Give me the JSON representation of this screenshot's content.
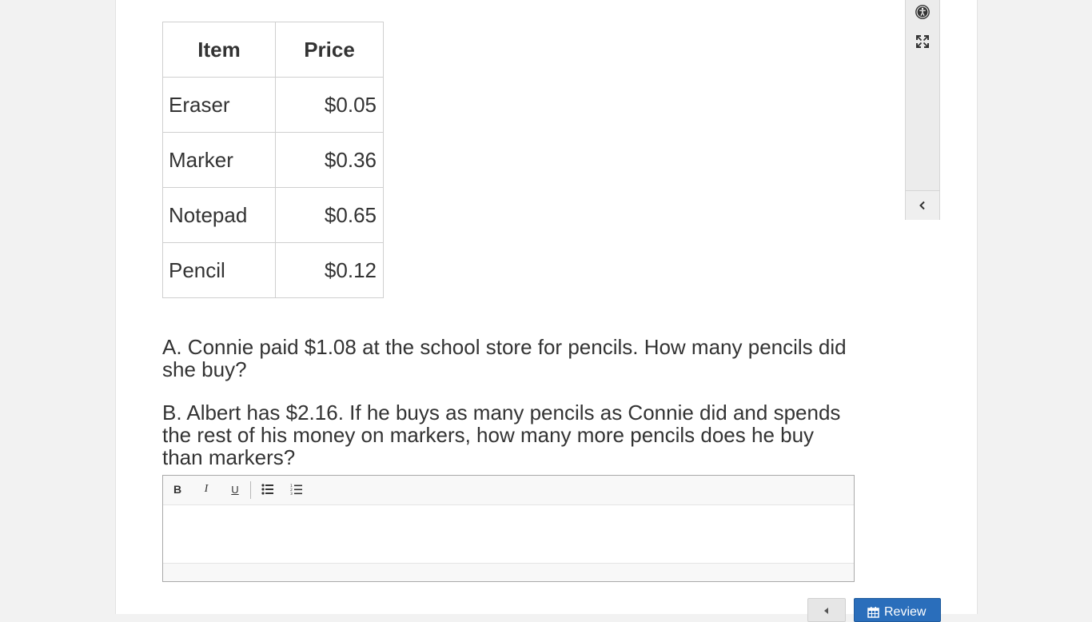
{
  "table": {
    "headers": {
      "item": "Item",
      "price": "Price"
    },
    "rows": [
      {
        "item": "Eraser",
        "price": "$0.05"
      },
      {
        "item": "Marker",
        "price": "$0.36"
      },
      {
        "item": "Notepad",
        "price": "$0.65"
      },
      {
        "item": "Pencil",
        "price": "$0.12"
      }
    ]
  },
  "questions": {
    "a": "A. Connie paid $1.08 at the school store for pencils.  How many pencils did she buy?",
    "b": "B. Albert has $2.16. If he buys as many pencils as Connie did and spends the rest of his money on markers, how many more pencils does he buy than markers?"
  },
  "editor": {
    "toolbar": {
      "bold": "B",
      "italic": "I",
      "underline": "U",
      "bullet_list_icon": "bulleted-list-icon",
      "numbered_list_icon": "numbered-list-icon"
    },
    "value": ""
  },
  "tool_rail": {
    "icons": [
      "accessibility-icon",
      "fullscreen-icon",
      "chevron-left-icon"
    ]
  },
  "nav": {
    "review_label": "Review",
    "review_icon": "calendar-icon",
    "prev_icon": "arrow-left-icon"
  },
  "colors": {
    "primary": "#2a6ebb",
    "background": "#f2f2f2",
    "text": "#333333"
  }
}
